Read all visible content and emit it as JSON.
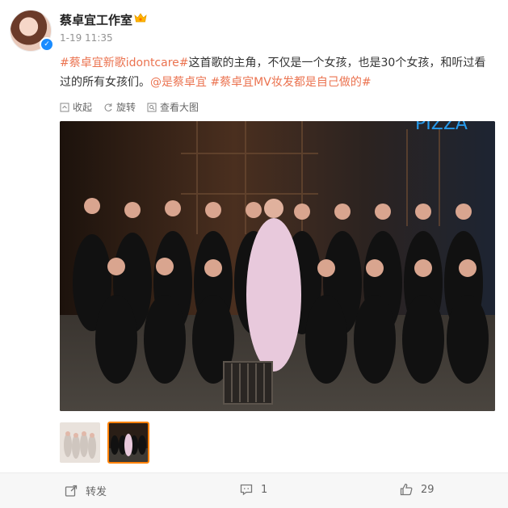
{
  "post": {
    "author": "蔡卓宜工作室",
    "time": "1-19 11:35",
    "content": {
      "hashtag1": "#蔡卓宜新歌idontcare#",
      "text1": "这首歌的主角，不仅是一个女孩，也是30个女孩，和听过看过的所有女孩们。",
      "mention": "@是蔡卓宜",
      "hashtag2": "#蔡卓宜MV妆发都是自己做的#"
    },
    "actions": {
      "collapse": "收起",
      "rotate": "旋转",
      "view_large": "查看大图"
    },
    "bottom": {
      "repost": "转发",
      "comments": "1",
      "likes": "29"
    }
  },
  "icons": {
    "verified": "verified-badge-icon",
    "crown": "crown-icon",
    "collapse": "collapse-icon",
    "rotate": "rotate-icon",
    "zoom": "zoom-icon",
    "repost": "repost-icon",
    "comment": "comment-icon",
    "like": "thumbs-up-icon"
  },
  "colors": {
    "tag": "#eb7350",
    "thumb_active_border": "#ff8200"
  }
}
